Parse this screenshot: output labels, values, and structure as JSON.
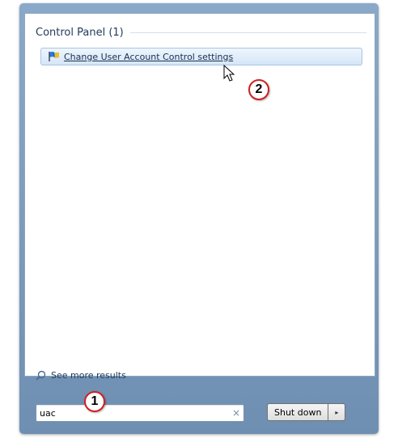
{
  "results": {
    "group_title": "Control Panel (1)",
    "items": [
      {
        "label": "Change User Account Control settings",
        "icon": "uac-flag-icon"
      }
    ]
  },
  "see_more": {
    "label": "See more results",
    "icon": "search-icon"
  },
  "search": {
    "value": "uac",
    "clear_icon": "×"
  },
  "shutdown": {
    "label": "Shut down",
    "arrow": "▸"
  },
  "callouts": {
    "first": "1",
    "second": "2"
  },
  "colors": {
    "frame": "#7a99bb",
    "group_title": "#1e395b",
    "highlight": "#d5e6f8",
    "callout_ring": "#d02020"
  }
}
